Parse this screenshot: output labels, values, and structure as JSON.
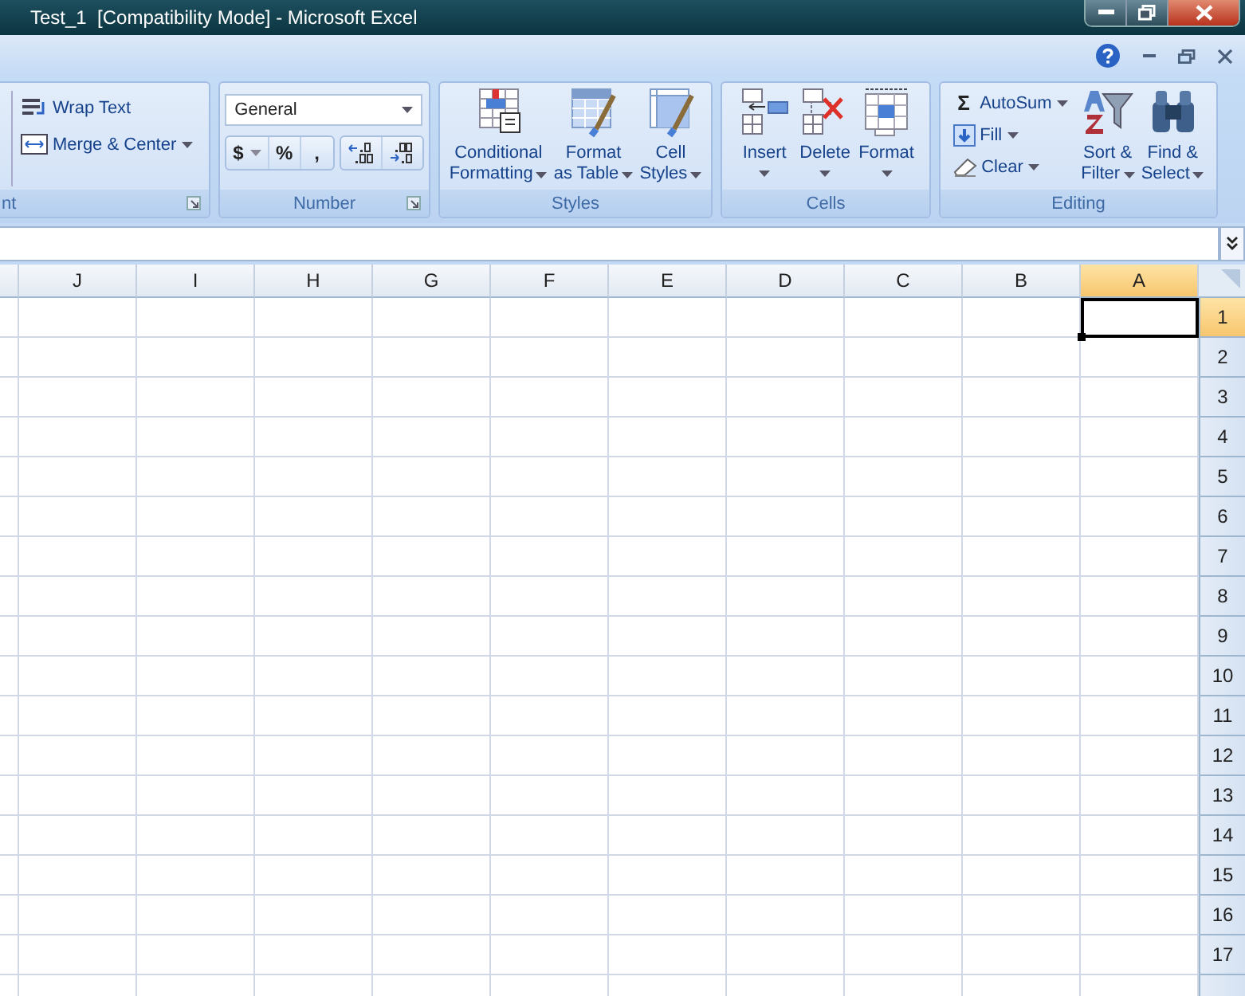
{
  "window": {
    "title": "Test_1  [Compatibility Mode] - Microsoft Excel"
  },
  "ribbon": {
    "groups": [
      {
        "kind": "alignment",
        "label": "nt",
        "launcher": true,
        "items": [
          {
            "label": "Wrap Text",
            "dropdown": false
          },
          {
            "label": "Merge & Center",
            "dropdown": true
          }
        ]
      },
      {
        "kind": "number",
        "label": "Number",
        "launcher": true,
        "format": "General",
        "buttons": [
          {
            "label": "$",
            "dropdown": true
          },
          {
            "label": "%",
            "dropdown": false
          },
          {
            "label": ",",
            "dropdown": false
          }
        ]
      },
      {
        "kind": "styles",
        "label": "Styles",
        "launcher": false,
        "items": [
          {
            "lines": [
              "Conditional",
              "Formatting"
            ],
            "dropdown": true
          },
          {
            "lines": [
              "Format",
              "as Table"
            ],
            "dropdown": true
          },
          {
            "lines": [
              "Cell",
              "Styles"
            ],
            "dropdown": true
          }
        ]
      },
      {
        "kind": "cells",
        "label": "Cells",
        "launcher": false,
        "items": [
          {
            "lines": [
              "Insert"
            ],
            "dropdown": true
          },
          {
            "lines": [
              "Delete"
            ],
            "dropdown": true
          },
          {
            "lines": [
              "Format"
            ],
            "dropdown": true
          }
        ]
      },
      {
        "kind": "editing",
        "label": "Editing",
        "launcher": false,
        "small": [
          {
            "symbol": "Σ",
            "label": "AutoSum",
            "dropdown": true
          },
          {
            "label": "Fill",
            "dropdown": true
          },
          {
            "label": "Clear",
            "dropdown": true
          }
        ],
        "items": [
          {
            "lines": [
              "Sort &",
              "Filter"
            ],
            "dropdown": true
          },
          {
            "lines": [
              "Find &",
              "Select"
            ],
            "dropdown": true
          }
        ]
      }
    ]
  },
  "sheet": {
    "columns": [
      {
        "label": "J",
        "selected": false
      },
      {
        "label": "I",
        "selected": false
      },
      {
        "label": "H",
        "selected": false
      },
      {
        "label": "G",
        "selected": false
      },
      {
        "label": "F",
        "selected": false
      },
      {
        "label": "E",
        "selected": false
      },
      {
        "label": "D",
        "selected": false
      },
      {
        "label": "C",
        "selected": false
      },
      {
        "label": "B",
        "selected": false
      },
      {
        "label": "A",
        "selected": true
      }
    ],
    "rows": [
      {
        "label": "1",
        "selected": true
      },
      {
        "label": "2",
        "selected": false
      },
      {
        "label": "3",
        "selected": false
      },
      {
        "label": "4",
        "selected": false
      },
      {
        "label": "5",
        "selected": false
      },
      {
        "label": "6",
        "selected": false
      },
      {
        "label": "7",
        "selected": false
      },
      {
        "label": "8",
        "selected": false
      },
      {
        "label": "9",
        "selected": false
      },
      {
        "label": "10",
        "selected": false
      },
      {
        "label": "11",
        "selected": false
      },
      {
        "label": "12",
        "selected": false
      },
      {
        "label": "13",
        "selected": false
      },
      {
        "label": "14",
        "selected": false
      },
      {
        "label": "15",
        "selected": false
      },
      {
        "label": "16",
        "selected": false
      },
      {
        "label": "17",
        "selected": false
      }
    ]
  }
}
